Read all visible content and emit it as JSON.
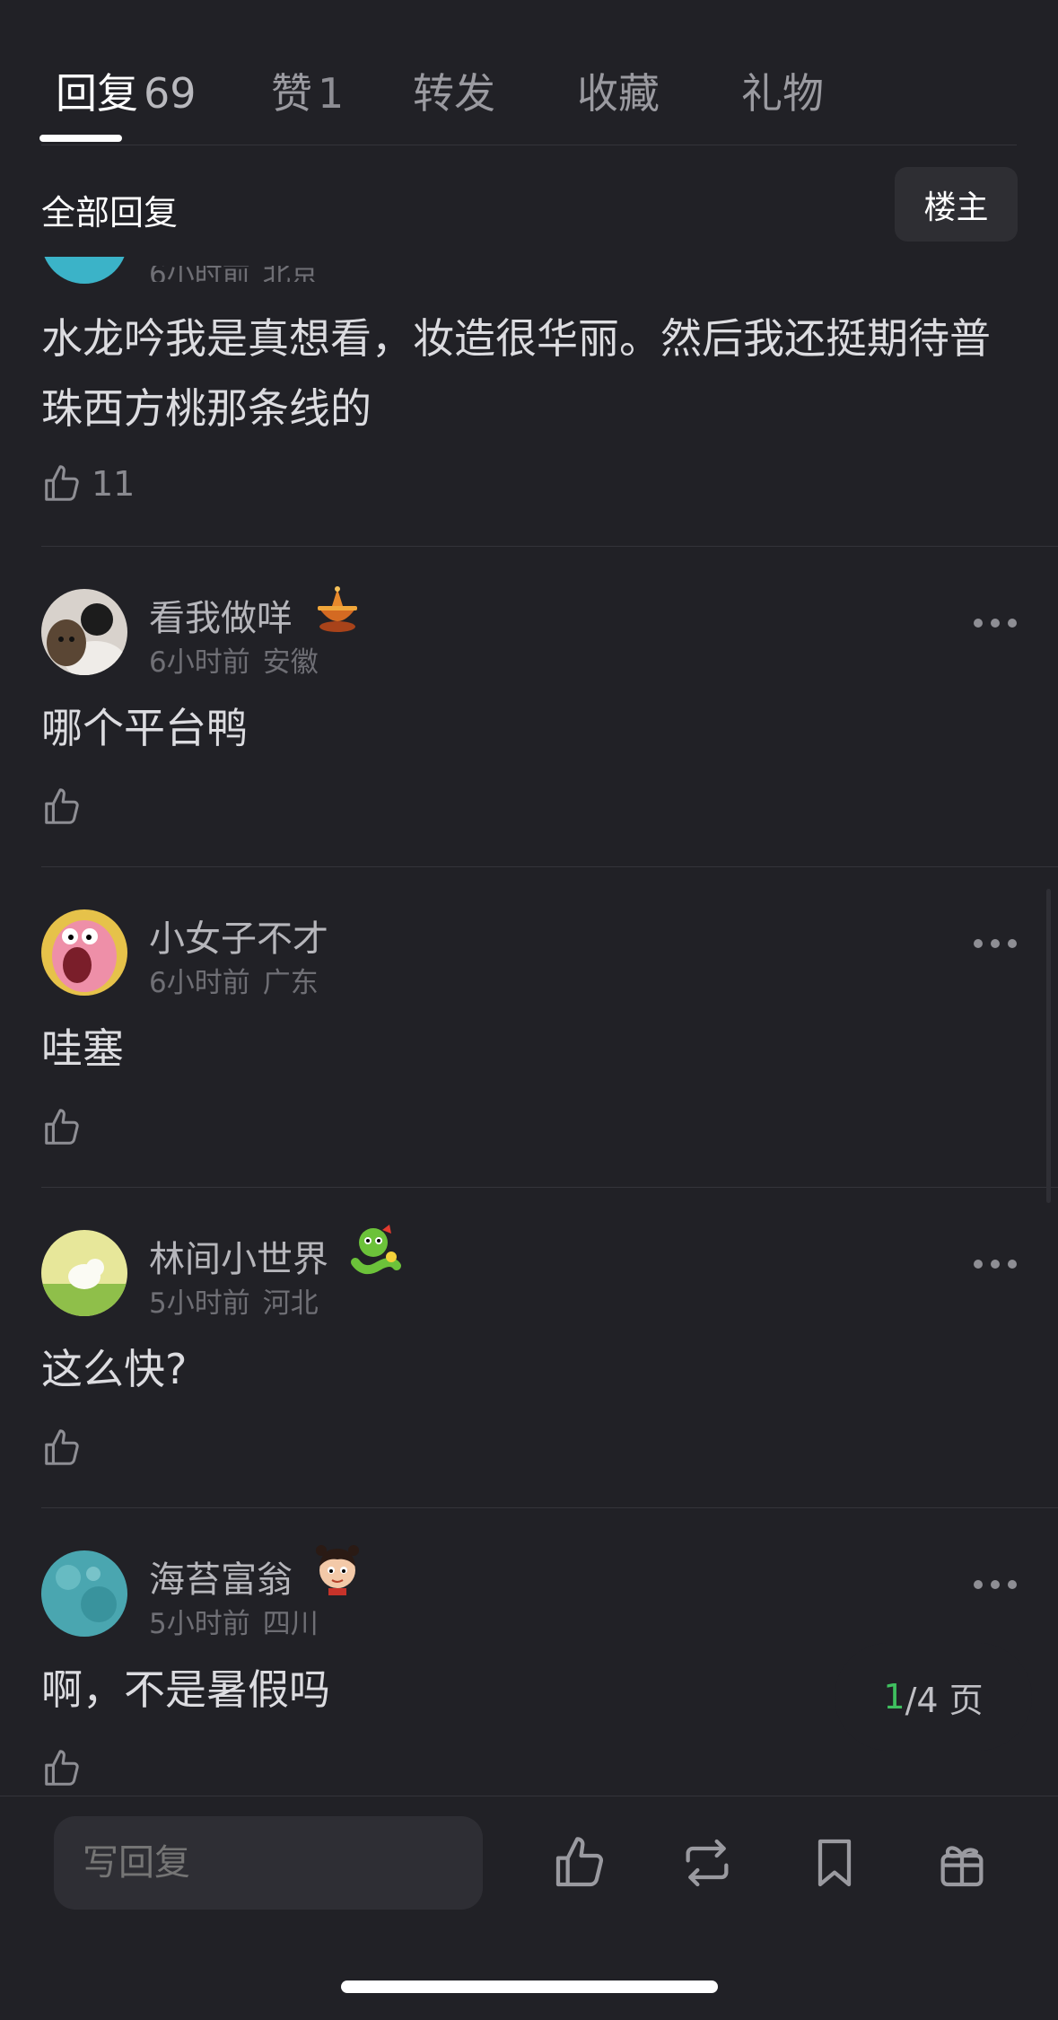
{
  "tabs": [
    {
      "label": "回复",
      "count": "69",
      "active": true
    },
    {
      "label": "赞",
      "count": "1"
    },
    {
      "label": "转发",
      "count": ""
    },
    {
      "label": "收藏",
      "count": ""
    },
    {
      "label": "礼物",
      "count": ""
    }
  ],
  "filter": {
    "title": "全部回复",
    "op_label": "楼主"
  },
  "partial_comment": {
    "meta_time": "6小时前",
    "meta_location": "北京",
    "text": "水龙吟我是真想看，妆造很华丽。然后我还挺期待普珠西方桃那条线的",
    "likes": "11"
  },
  "comments": [
    {
      "name": "看我做咩",
      "time": "6小时前",
      "location": "安徽",
      "text": "哪个平台鸭",
      "likes": "",
      "badge": "hotpot-icon"
    },
    {
      "name": "小女子不才",
      "time": "6小时前",
      "location": "广东",
      "text": "哇塞",
      "likes": "",
      "badge": ""
    },
    {
      "name": "林间小世界",
      "time": "5小时前",
      "location": "河北",
      "text": "这么快?",
      "likes": "",
      "badge": "snake-icon"
    },
    {
      "name": "海苔富翁",
      "time": "5小时前",
      "location": "四川",
      "text": "啊，不是暑假吗",
      "likes": "",
      "badge": "child-icon"
    }
  ],
  "pager": {
    "current": "1",
    "rest": "/4 页"
  },
  "bottom": {
    "reply_placeholder": "写回复"
  },
  "colors": {
    "background": "#212126",
    "accent_green": "#3fbf5f"
  }
}
